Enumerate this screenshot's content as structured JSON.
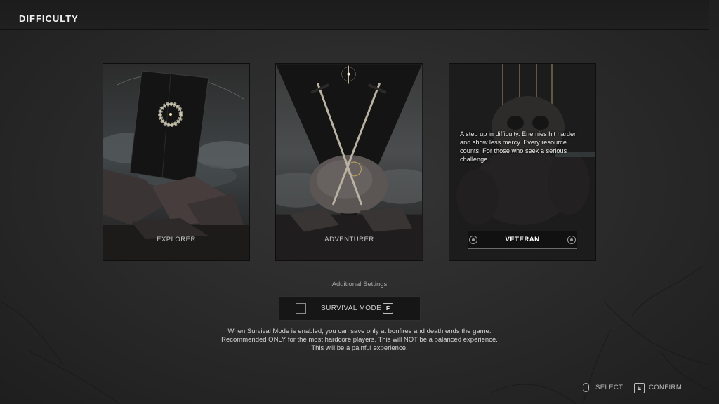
{
  "header": {
    "title": "DIFFICULTY"
  },
  "cards": [
    {
      "label": "EXPLORER",
      "selected": false,
      "art_icon": "wreath-monolith-icon"
    },
    {
      "label": "ADVENTURER",
      "selected": false,
      "art_icon": "crossed-swords-icon"
    },
    {
      "label": "VETERAN",
      "selected": true,
      "art_icon": "skull-icon",
      "description": "A step up in difficulty. Enemies hit harder and show less mercy. Every resource counts. For those who seek a serious challenge."
    }
  ],
  "additional": {
    "title": "Additional Settings",
    "survival_label": "SURVIVAL MODE",
    "survival_checked": false,
    "survival_key": "F",
    "warning_lines": [
      "When Survival Mode is enabled, you can save only at bonfires and death ends the game.",
      "Recommended ONLY for the most hardcore players. This will NOT be a balanced experience.",
      "This will be a painful experience."
    ]
  },
  "hints": {
    "select_label": "SELECT",
    "select_icon": "mouse-icon",
    "confirm_key": "E",
    "confirm_label": "CONFIRM"
  },
  "colors": {
    "background": "#2a2a2a",
    "topbar": "#1c1c1c",
    "text": "#d9d9d9",
    "accent_gold": "#c8b27a"
  }
}
